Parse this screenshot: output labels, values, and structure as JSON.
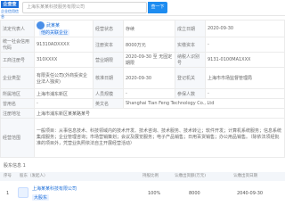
{
  "header": {
    "logo_text": "企查查",
    "logo_sub": "企业信用信息",
    "search_value": "上海东某某科技服务有限公司",
    "search_button": "查一下"
  },
  "rows": {
    "r1": {
      "l1": "法定代表人",
      "v1": "武某某",
      "tag": "他的关联企业",
      "l2": "经营状态",
      "v2": "存续",
      "l3": "成立日期",
      "v3": "2020-09-30"
    },
    "r2": {
      "l1": "统一社会信用代码",
      "v1": "91310ADXXXX",
      "l2": "注册资本",
      "v2": "8000万元",
      "l3": "实缴资本",
      "v3": "-"
    },
    "r3": {
      "l1": "工商注册号",
      "v1": "310XXXX",
      "l2": "营业期限",
      "v2": "2020-09-30 至 无固定期限",
      "l3": "纳税人识别号",
      "v3": "9131-0100MA1XXX"
    },
    "r4": {
      "l1": "企业类型",
      "v1": "有限责任公司(外商投资企业法人独资)",
      "l2": "核准日期",
      "v2": "2020-09-30",
      "l3": "登记机关",
      "v3": "上海市市场监督管理局"
    },
    "r5": {
      "l1": "所属地区",
      "v1": "上海市浦东新区",
      "l2": "人员规模",
      "v2": "-",
      "l3": "参保人数",
      "v3": "-"
    },
    "r6": {
      "l1": "曾用名",
      "v1": "-",
      "l2": "英文名",
      "v2": "Shanghai Tian Feng Technology Co., Ltd"
    },
    "r7": {
      "l1": "注册地址",
      "v1": "上海市浦东新区某某路某号"
    },
    "r8": {
      "l1": "经营范围",
      "v1": "一般项目：从事信息技术、科技领域内的技术开发、技术咨询、技术服务、技术转让；软件开发；计算机系统服务；信息系统集成服务；企业管理咨询；市场营销策划；会议及展览服务；电子产品销售；日用百货销售；办公用品销售。（除依法须经批准的项目外，凭营业执照依法自主开展经营活动）"
    }
  },
  "shareholders": {
    "title": "股东信息 1",
    "headers": [
      "序号",
      "股东（发起人）",
      "持股比例",
      "认缴出资额(万元)",
      "认缴出资日期"
    ],
    "row": {
      "index": "1",
      "name": "上海某某科技有限公司",
      "tag": "大股东",
      "ratio": "100%",
      "amount": "8000",
      "date": "2040-09-30"
    }
  }
}
